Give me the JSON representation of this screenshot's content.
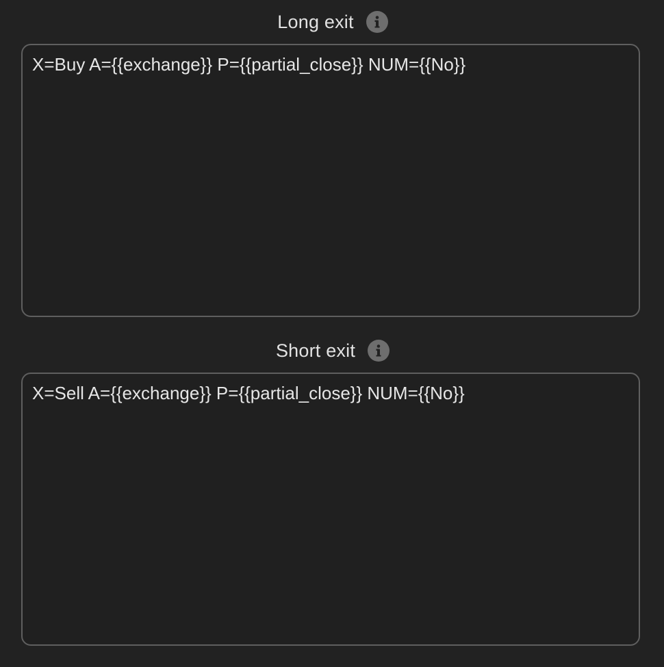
{
  "long_exit": {
    "label": "Long exit",
    "value": "X=Buy A={{exchange}} P={{partial_close}} NUM={{No}}"
  },
  "short_exit": {
    "label": "Short exit",
    "value": "X=Sell A={{exchange}} P={{partial_close}} NUM={{No}}"
  },
  "colors": {
    "background": "#222222",
    "field_border": "#5f5f5f",
    "label_text": "#e2e2e2",
    "info_icon": "#6e6e6e"
  },
  "icons": {
    "help": "info-icon"
  }
}
